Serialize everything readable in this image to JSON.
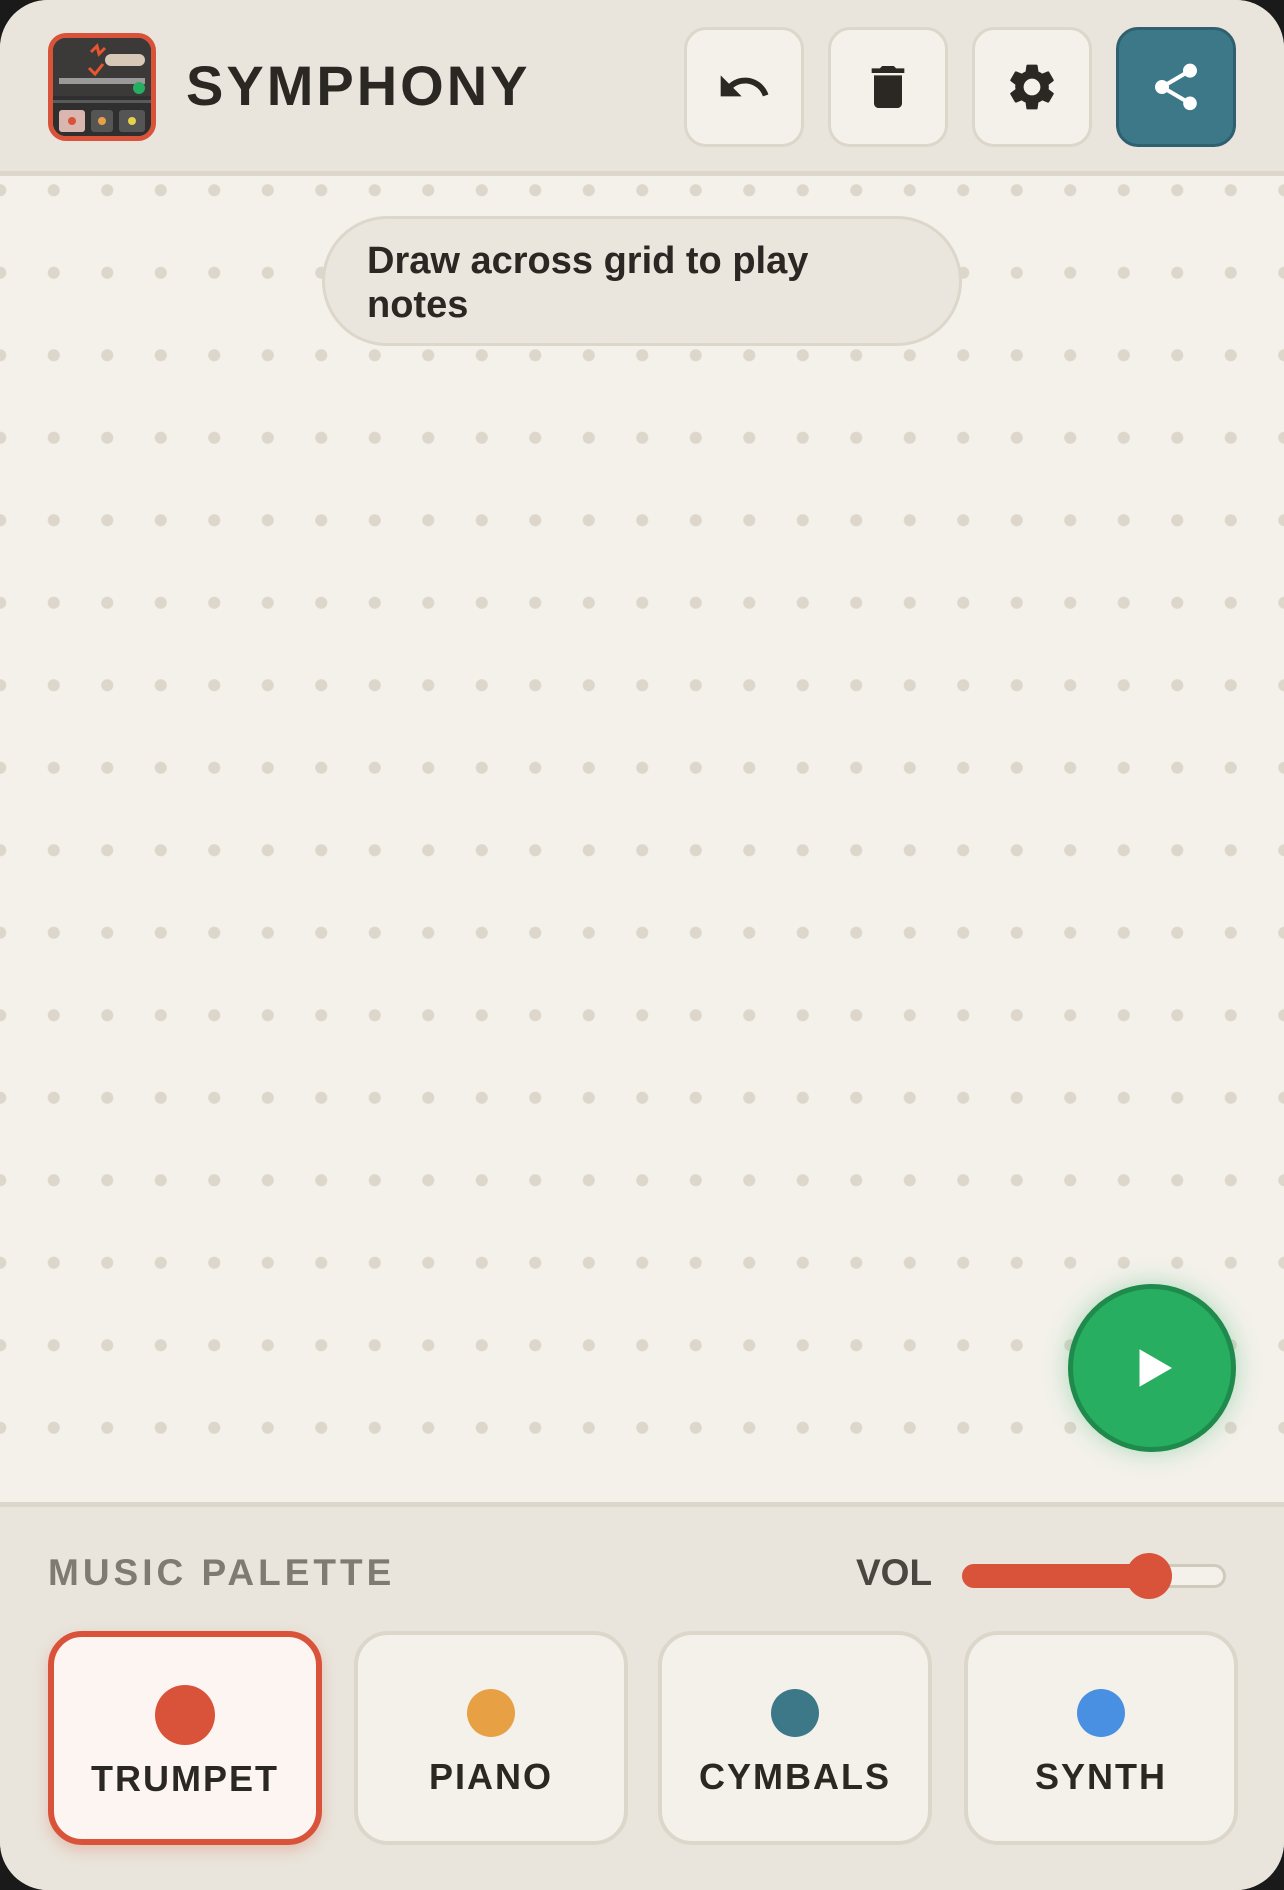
{
  "app": {
    "title": "SYMPHONY"
  },
  "header": {
    "buttons": [
      {
        "icon": "undo-icon"
      },
      {
        "icon": "trash-icon"
      },
      {
        "icon": "gear-icon"
      },
      {
        "icon": "share-icon"
      }
    ]
  },
  "canvas": {
    "hint": "Draw across grid to play notes"
  },
  "palette": {
    "label": "MUSIC PALETTE",
    "volume_label": "VOL",
    "volume_level": 0.75,
    "selected": "TRUMPET",
    "instruments": [
      {
        "name": "TRUMPET",
        "color": "#d9533a"
      },
      {
        "name": "PIANO",
        "color": "#e8a045"
      },
      {
        "name": "CYMBALS",
        "color": "#3d7889"
      },
      {
        "name": "SYNTH",
        "color": "#4a90e2"
      }
    ]
  },
  "colors": {
    "accent": "#d9533a",
    "share": "#3d7889",
    "play": "#27ae60",
    "background": "#f3f1ea"
  }
}
